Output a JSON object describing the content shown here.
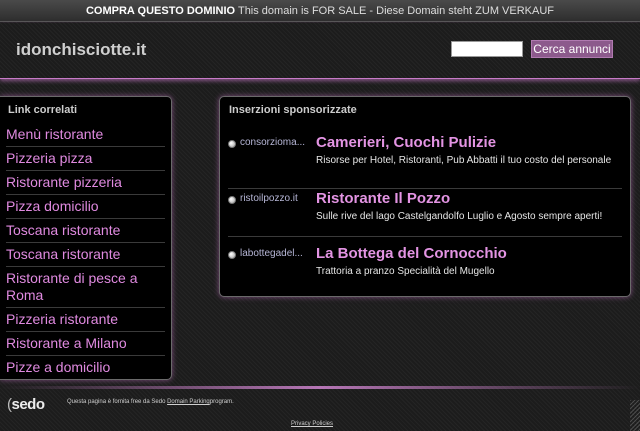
{
  "topbar": {
    "strong_text": "COMPRA QUESTO DOMINIO",
    "text": "This domain is FOR SALE - Diese Domain steht ZUM VERKAUF"
  },
  "header": {
    "site_title": "idonchisciotte.it",
    "search_value": "",
    "search_button_label": "Cerca annunci"
  },
  "related_links": {
    "heading": "Link correlati",
    "items": [
      "Menù ristorante",
      "Pizzeria pizza",
      "Ristorante pizzeria",
      "Pizza domicilio",
      "Toscana ristorante",
      "Toscana ristorante",
      "Ristorante di pesce a Roma",
      "Pizzeria ristorante",
      "Ristorante a Milano",
      "Pizze a domicilio"
    ]
  },
  "sponsored": {
    "heading": "Inserzioni sponsorizzate",
    "ads": [
      {
        "domain": "consorzioma...",
        "title": "Camerieri, Cuochi Pulizie",
        "description": "Risorse per Hotel, Ristoranti, Pub Abbatti il tuo costo del personale"
      },
      {
        "domain": "ristoilpozzo.it",
        "title": "Ristorante Il Pozzo",
        "description": "Sulle rive del lago Castelgandolfo Luglio e Agosto sempre aperti!"
      },
      {
        "domain": "labottegadel...",
        "title": "La Bottega del Cornocchio",
        "description": "Trattoria a pranzo Specialità del Mugello"
      }
    ]
  },
  "footer": {
    "logo_text": "sedo",
    "text_before": "Questa pagina è fornita free da Sedo",
    "link_text": "Domain Parking",
    "text_after": "program.",
    "privacy_label": "Privacy Policies"
  }
}
